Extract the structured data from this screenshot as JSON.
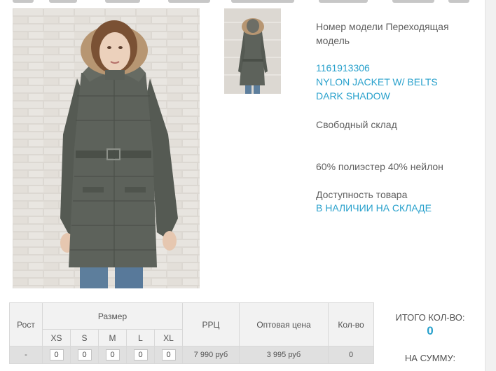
{
  "product": {
    "model_label": "Номер модели Переходящая модель",
    "sku": "1161913306",
    "name_line1": "NYLON JACKET W/ BELTS",
    "name_line2": "DARK SHADOW",
    "warehouse": "Свободный склад",
    "composition": "60% полиэстер 40% нейлон",
    "availability_label": "Доступность товара",
    "availability_value": "В НАЛИЧИИ НА СКЛАДЕ"
  },
  "table": {
    "headers": {
      "height": "Рост",
      "size": "Размер",
      "rrp": "РРЦ",
      "wholesale": "Оптовая цена",
      "qty": "Кол-во"
    },
    "sizes": [
      "XS",
      "S",
      "M",
      "L",
      "XL"
    ],
    "row": {
      "height": "-",
      "quantities": [
        "0",
        "0",
        "0",
        "0",
        "0"
      ],
      "rrp": "7 990 руб",
      "wholesale": "3 995 руб",
      "qty": "0"
    }
  },
  "totals": {
    "qty_label": "ИТОГО КОЛ-ВО:",
    "qty_value": "0",
    "sum_label": "НА СУММУ:"
  },
  "colors": {
    "accent": "#29a1cc",
    "jacket": "#5d625b",
    "jeans": "#5d7e9c"
  }
}
